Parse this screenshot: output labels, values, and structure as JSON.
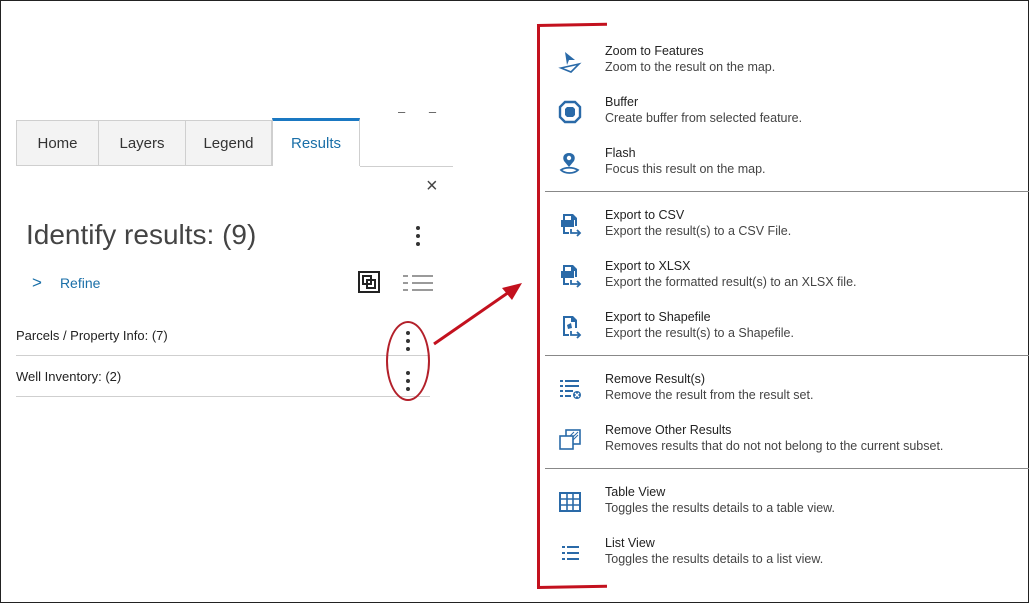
{
  "tabs": [
    {
      "label": "Home"
    },
    {
      "label": "Layers"
    },
    {
      "label": "Legend"
    },
    {
      "label": "Results",
      "active": true
    }
  ],
  "close_symbol": "×",
  "ghost_marks": "– –",
  "panel": {
    "title": "Identify results: (9)",
    "refine_chevron": ">",
    "refine_label": "Refine",
    "results": [
      {
        "label": "Parcels / Property Info: (7)"
      },
      {
        "label": "Well Inventory: (2)"
      }
    ]
  },
  "colors": {
    "accent_blue": "#1a6fa8",
    "annotation_red": "#c3111e",
    "icon_blue": "#2a6aa8"
  },
  "menu": {
    "groups": [
      [
        {
          "icon": "zoom-to-features-icon",
          "label": "Zoom to Features",
          "description": "Zoom to the result on the map."
        },
        {
          "icon": "buffer-icon",
          "label": "Buffer",
          "description": "Create buffer from selected feature."
        },
        {
          "icon": "flash-icon",
          "label": "Flash",
          "description": "Focus this result on the map."
        }
      ],
      [
        {
          "icon": "export-csv-icon",
          "label": "Export to CSV",
          "description": "Export the result(s) to a CSV File."
        },
        {
          "icon": "export-xlsx-icon",
          "label": "Export to XLSX",
          "description": "Export the formatted result(s) to an XLSX file."
        },
        {
          "icon": "export-shapefile-icon",
          "label": "Export to Shapefile",
          "description": "Export the result(s) to a Shapefile."
        }
      ],
      [
        {
          "icon": "remove-results-icon",
          "label": "Remove Result(s)",
          "description": "Remove the result from the result set."
        },
        {
          "icon": "remove-other-results-icon",
          "label": "Remove Other Results",
          "description": "Removes results that do not not belong to the current subset."
        }
      ],
      [
        {
          "icon": "table-view-icon",
          "label": "Table View",
          "description": "Toggles the results details to a table view."
        },
        {
          "icon": "list-view-icon",
          "label": "List View",
          "description": "Toggles the results details to a list view."
        }
      ]
    ]
  }
}
